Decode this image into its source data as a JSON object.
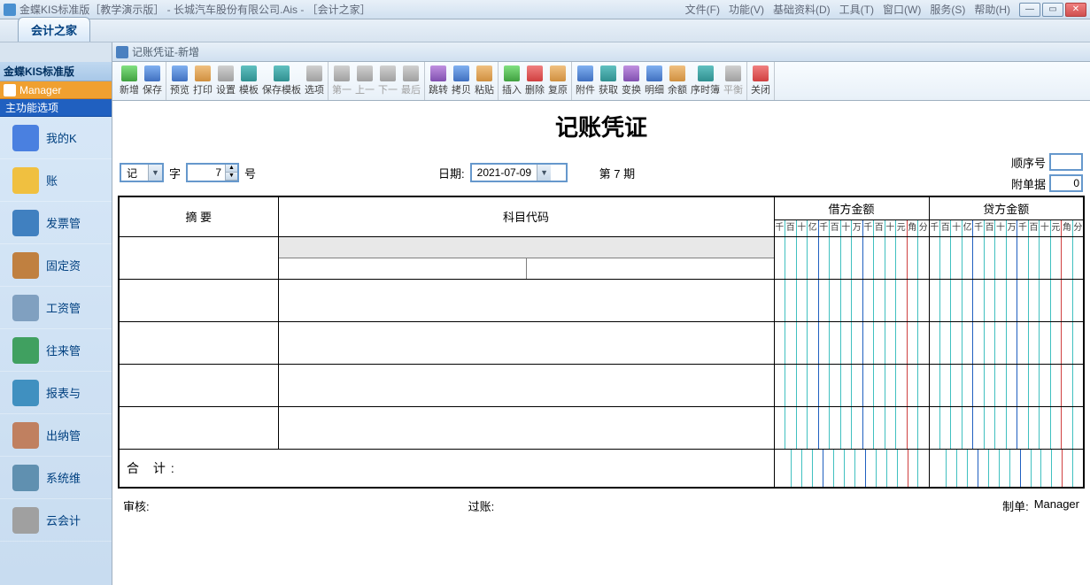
{
  "titlebar": {
    "title": "金蝶KIS标准版［教学演示版］ - 长城汽车股份有限公司.Ais - ［会计之家］",
    "menus": [
      "文件(F)",
      "功能(V)",
      "基础资料(D)",
      "工具(T)",
      "窗口(W)",
      "服务(S)",
      "帮助(H)"
    ]
  },
  "tab": "会计之家",
  "subwindow": "记账凭证-新增",
  "sidebar": {
    "brand": "金蝶KIS标准版",
    "user": "Manager",
    "main_opts": "主功能选项",
    "items": [
      "我的K",
      "账",
      "发票管",
      "固定资",
      "工资管",
      "往来管",
      "报表与",
      "出纳管",
      "系统维",
      "云会计"
    ]
  },
  "toolbar": {
    "groups": [
      [
        {
          "l": "新增",
          "c": "green"
        },
        {
          "l": "保存",
          "c": "blue"
        }
      ],
      [
        {
          "l": "预览",
          "c": "blue"
        },
        {
          "l": "打印",
          "c": "orange"
        },
        {
          "l": "设置",
          "c": "gray"
        },
        {
          "l": "模板",
          "c": "teal"
        },
        {
          "l": "保存模板",
          "c": "teal"
        },
        {
          "l": "选项",
          "c": "gray"
        }
      ],
      [
        {
          "l": "第一",
          "c": "gray",
          "d": true
        },
        {
          "l": "上一",
          "c": "gray",
          "d": true
        },
        {
          "l": "下一",
          "c": "gray",
          "d": true
        },
        {
          "l": "最后",
          "c": "gray",
          "d": true
        }
      ],
      [
        {
          "l": "跳转",
          "c": "violet"
        },
        {
          "l": "拷贝",
          "c": "blue"
        },
        {
          "l": "粘贴",
          "c": "orange"
        }
      ],
      [
        {
          "l": "插入",
          "c": "green"
        },
        {
          "l": "删除",
          "c": "red"
        },
        {
          "l": "复原",
          "c": "orange"
        }
      ],
      [
        {
          "l": "附件",
          "c": "blue"
        },
        {
          "l": "获取",
          "c": "teal"
        },
        {
          "l": "变换",
          "c": "violet"
        },
        {
          "l": "明细",
          "c": "blue"
        },
        {
          "l": "余额",
          "c": "orange"
        },
        {
          "l": "序时簿",
          "c": "teal"
        },
        {
          "l": "平衡",
          "c": "gray",
          "d": true
        }
      ],
      [
        {
          "l": "关闭",
          "c": "red"
        }
      ]
    ]
  },
  "voucher": {
    "title": "记账凭证",
    "kind": "记",
    "word": "字",
    "number": "7",
    "number_suffix": "号",
    "date_label": "日期:",
    "date": "2021-07-09",
    "period_prefix": "第",
    "period_num": "7",
    "period_suffix": "期",
    "seq_label": "顺序号",
    "attach_label": "附单据",
    "attach_val": "0",
    "headers": {
      "summary": "摘    要",
      "code": "科目代码",
      "debit": "借方金额",
      "credit": "贷方金额"
    },
    "digits": [
      "千",
      "百",
      "十",
      "亿",
      "千",
      "百",
      "十",
      "万",
      "千",
      "百",
      "十",
      "元",
      "角",
      "分"
    ],
    "total_label": "合    计:",
    "sig_audit": "审核:",
    "sig_post": "过账:",
    "sig_make": "制单:",
    "maker": "Manager"
  }
}
